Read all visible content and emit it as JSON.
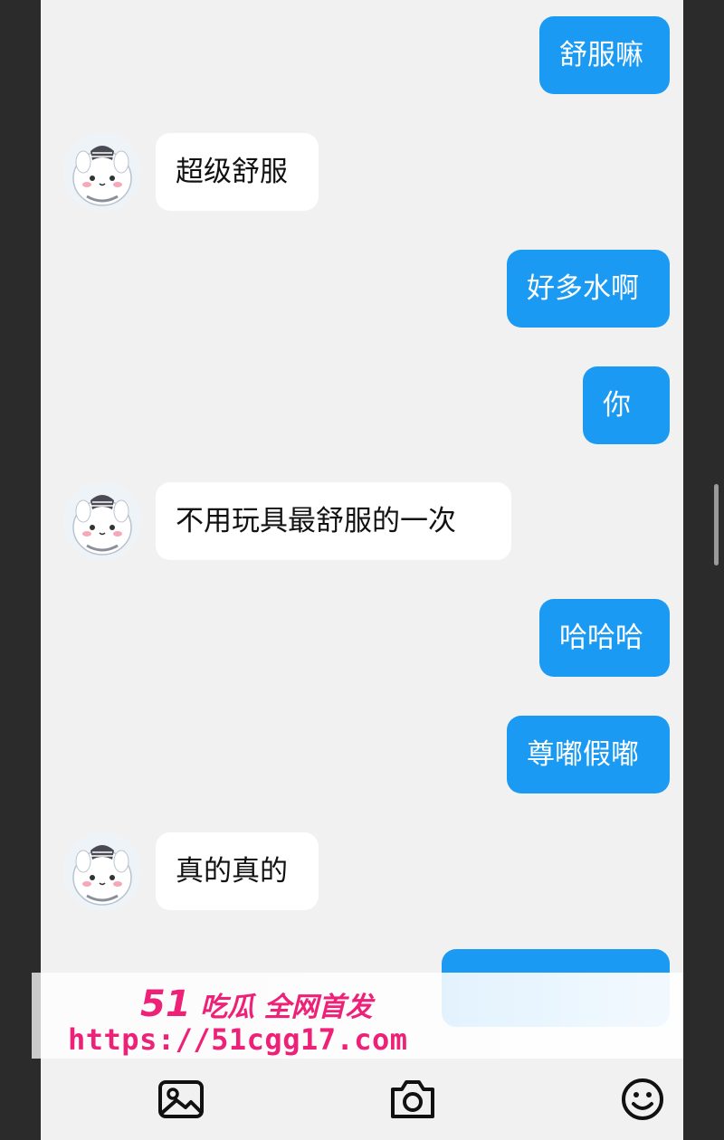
{
  "messages": [
    {
      "side": "out",
      "text": "舒服嘛"
    },
    {
      "side": "in",
      "text": "超级舒服"
    },
    {
      "side": "out",
      "text": "好多水啊"
    },
    {
      "side": "out",
      "text": "你"
    },
    {
      "side": "in",
      "text": "不用玩具最舒服的一次"
    },
    {
      "side": "out",
      "text": "哈哈哈"
    },
    {
      "side": "out",
      "text": "尊嘟假嘟"
    },
    {
      "side": "in",
      "text": "真的真的"
    }
  ],
  "watermark": {
    "brand_number": "51",
    "brand_text": "吃瓜 全网首发",
    "url": "https://51cgg17.com"
  },
  "toolbar": {
    "icons": [
      "image-icon",
      "camera-icon",
      "emoji-icon"
    ]
  },
  "colors": {
    "outgoing_bubble": "#1a9af2",
    "incoming_bubble": "#ffffff",
    "background": "#f1f1f2",
    "watermark": "#ee2178"
  }
}
